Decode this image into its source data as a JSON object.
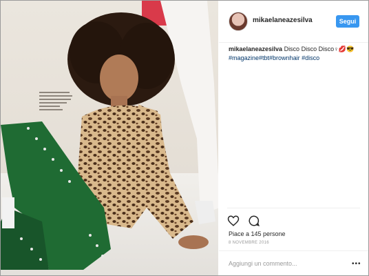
{
  "post": {
    "username": "mikaelaneazesilva",
    "follow_label": "Segui",
    "caption_user": "mikaelaneazesilva",
    "caption_text": " Disco Disco Disco♀💋😎",
    "caption_tags": "#magazine#tbt#brownhair #disco",
    "likes_text": "Piace a 145 persone",
    "date_text": "8 NOVEMBRE 2016",
    "comment_placeholder": "Aggiungi un commento...",
    "more_label": "•••"
  },
  "icons": {
    "like": "heart-icon",
    "comment": "comment-icon",
    "avatar": "avatar",
    "more": "more-options-icon"
  },
  "colors": {
    "follow_button": "#3897f0",
    "hashtag": "#003569",
    "text": "#262626",
    "muted": "#999999"
  }
}
